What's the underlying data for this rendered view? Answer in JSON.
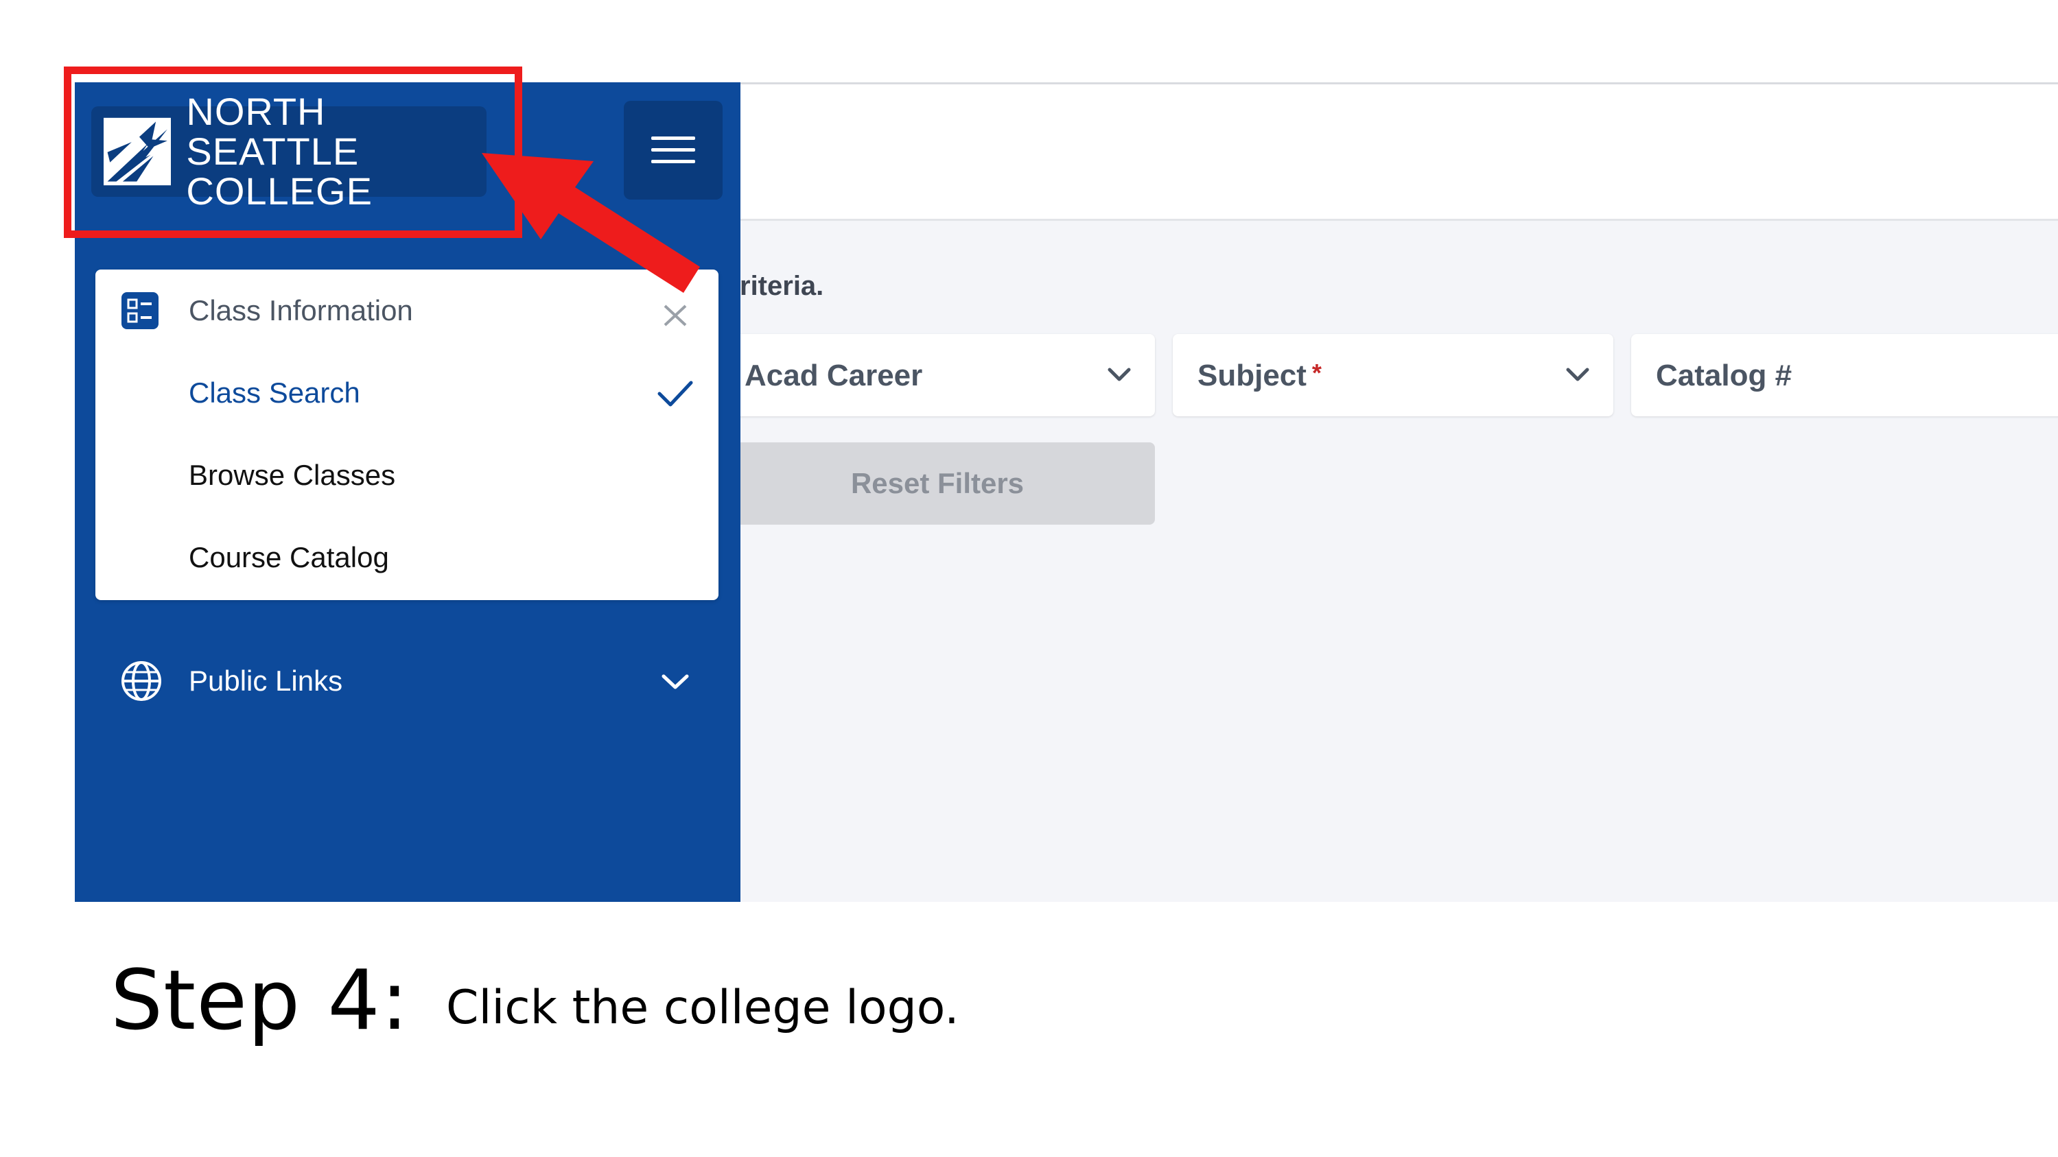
{
  "sidebar": {
    "logo_text": "NORTH SEATTLE\nCOLLEGE",
    "menu_button_icon": "hamburger-icon",
    "class_information": {
      "label": "Class Information",
      "icon": "list-icon",
      "expanded_icon": "close-icon",
      "items": [
        {
          "label": "Class Search",
          "selected": true,
          "trail_icon": "check-icon"
        },
        {
          "label": "Browse Classes"
        },
        {
          "label": "Course Catalog"
        }
      ]
    },
    "public_links": {
      "label": "Public Links",
      "icon": "globe-icon",
      "trail_icon": "chevron-down-icon"
    }
  },
  "main": {
    "criteria_text": "riteria.",
    "filters": [
      {
        "label": "Acad Career",
        "required": false
      },
      {
        "label": "Subject",
        "required": true,
        "required_mark": "*"
      },
      {
        "label": "Catalog #",
        "required": false
      }
    ],
    "reset_label": "Reset Filters"
  },
  "caption": {
    "step": "Step 4:",
    "instruction_prefix": "Click the ",
    "instruction_emphasis": "college logo",
    "instruction_suffix": "."
  },
  "colors": {
    "sidebar": "#0d4a9b",
    "logo_bg": "#0b3d80",
    "selected_item": "#0d4a9b",
    "highlight": "#ee1c1c",
    "content_bg": "#f4f5f9"
  }
}
